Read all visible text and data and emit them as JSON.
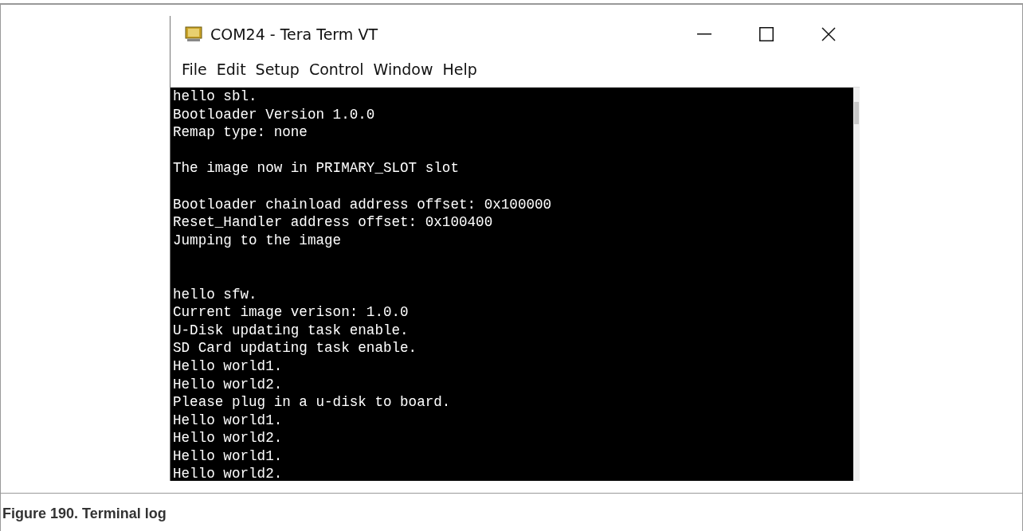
{
  "window": {
    "title": "COM24 - Tera Term VT"
  },
  "menu": [
    "File",
    "Edit",
    "Setup",
    "Control",
    "Window",
    "Help"
  ],
  "terminal": {
    "blocks": [
      {
        "kind": "top",
        "lines": [
          "hello sbl.",
          "Bootloader Version 1.0.0",
          "Remap type: none"
        ]
      },
      {
        "kind": "spaced",
        "lines": [
          "The image now in PRIMARY_SLOT slot"
        ]
      },
      {
        "kind": "spaced",
        "lines": [
          "Bootloader chainload address offset: 0x100000",
          "Reset_Handler address offset: 0x100400",
          "Jumping to the image"
        ]
      },
      {
        "kind": "wide",
        "lines": [
          "hello sfw.",
          "Current image verison: 1.0.0",
          "U-Disk updating task enable.",
          "SD Card updating task enable.",
          "Hello world1.",
          "Hello world2.",
          "Please plug in a u-disk to board.",
          "Hello world1.",
          "Hello world2.",
          "Hello world1.",
          "Hello world2."
        ]
      }
    ]
  },
  "caption": "Figure 190. Terminal log"
}
